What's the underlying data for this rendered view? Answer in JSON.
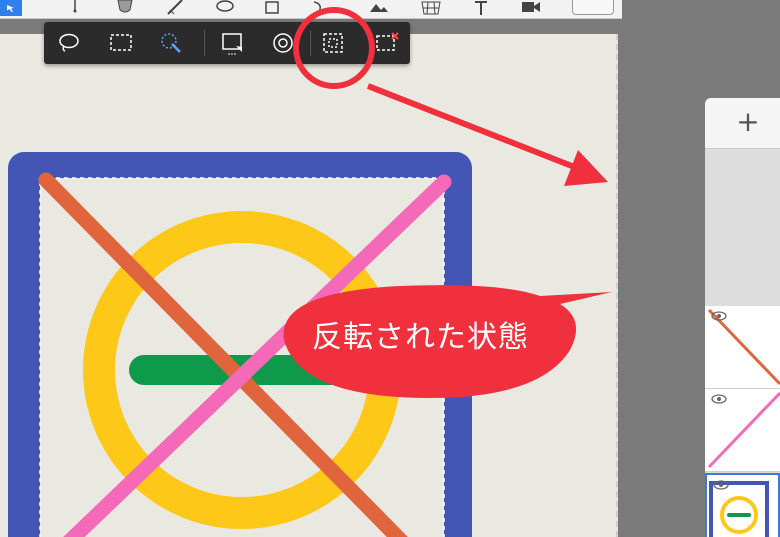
{
  "toolbar": {
    "tools": [
      "move-tool",
      "pen-tool",
      "fill-tool",
      "brush-tool",
      "lasso-tool",
      "shape-tool",
      "text-tool",
      "image-tool",
      "perspective-tool",
      "type-tool",
      "video-tool"
    ]
  },
  "selection_toolbar": {
    "buttons": [
      "lasso-select",
      "rectangle-select",
      "magic-wand-select",
      "transform",
      "rotate",
      "flip",
      "deselect"
    ],
    "highlighted_button": "flip"
  },
  "annotation": {
    "callout_text": "反転された状態",
    "callout_color": "#f0303c"
  },
  "layers_panel": {
    "add_label": "+",
    "layers": [
      {
        "name": "orange-line-layer",
        "visible": true
      },
      {
        "name": "pink-line-layer",
        "visible": true
      },
      {
        "name": "circle-layer",
        "visible": true,
        "selected": true
      }
    ]
  },
  "colors": {
    "frame": "#4356b5",
    "circle": "#fdc817",
    "bar": "#0e9a4a",
    "orange_line": "#e0643c",
    "pink_line": "#f46ab8",
    "canvas": "#eae9e1",
    "accent": "#3a7bd5"
  }
}
